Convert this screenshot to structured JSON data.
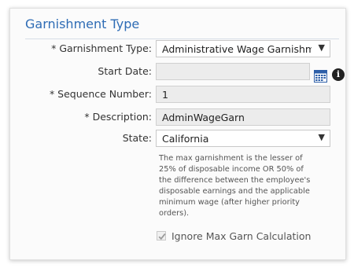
{
  "section": {
    "title": "Garnishment Type"
  },
  "form": {
    "garnishment_type": {
      "label": "* Garnishment Type:",
      "value": "Administrative Wage Garnishment"
    },
    "start_date": {
      "label": "Start Date:",
      "value": ""
    },
    "sequence_number": {
      "label": "* Sequence Number:",
      "value": "1"
    },
    "description": {
      "label": "* Description:",
      "value": "AdminWageGarn"
    },
    "state": {
      "label": "State:",
      "value": "California"
    }
  },
  "note": "The max garnishment is the lesser of 25% of disposable income OR 50% of the difference between the employee's disposable earnings and the applicable minimum wage (after higher priority orders).",
  "checkbox": {
    "label": "Ignore Max Garn Calculation",
    "checked": true
  },
  "icons": {
    "dropdown": "chevron-down-icon",
    "calendar": "calendar-icon",
    "info": "info-icon",
    "check": "checkmark-icon"
  },
  "colors": {
    "title": "#2e6cb5",
    "readonly_field": "#ececec",
    "calendar": "#2e5fa8"
  }
}
